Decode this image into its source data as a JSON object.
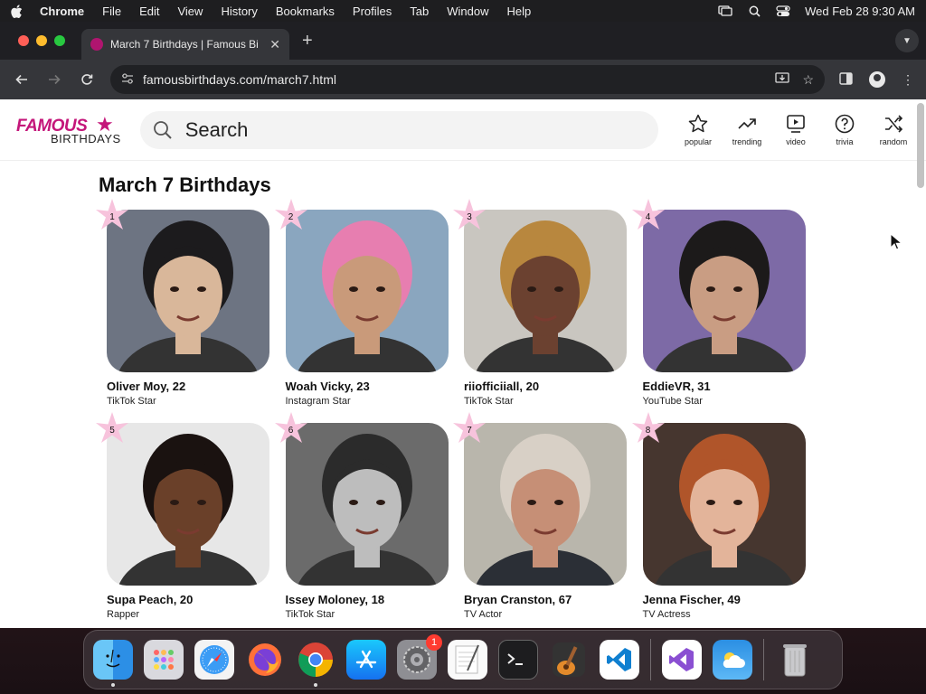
{
  "menubar": {
    "app_name": "Chrome",
    "items": [
      "File",
      "Edit",
      "View",
      "History",
      "Bookmarks",
      "Profiles",
      "Tab",
      "Window",
      "Help"
    ],
    "clock": "Wed Feb 28  9:30 AM"
  },
  "browser": {
    "tab_title": "March 7 Birthdays | Famous Bi",
    "url": "famousbirthdays.com/march7.html"
  },
  "site": {
    "logo_top": "FAMOUS",
    "logo_bottom": "BIRTHDAYS",
    "search_placeholder": "Search",
    "nav": [
      {
        "label": "popular",
        "icon": "star-icon"
      },
      {
        "label": "trending",
        "icon": "trending-icon"
      },
      {
        "label": "video",
        "icon": "video-icon"
      },
      {
        "label": "trivia",
        "icon": "question-icon"
      },
      {
        "label": "random",
        "icon": "shuffle-icon"
      }
    ],
    "heading": "March 7 Birthdays"
  },
  "celebrities": [
    {
      "rank": "1",
      "name": "Oliver Moy, 22",
      "job": "TikTok Star",
      "bg": "#6d7482",
      "skin": "#d9b79a",
      "hair": "#1c1b1d"
    },
    {
      "rank": "2",
      "name": "Woah Vicky, 23",
      "job": "Instagram Star",
      "bg": "#8aa6bf",
      "skin": "#c99a7a",
      "hair": "#e77eb0"
    },
    {
      "rank": "3",
      "name": "riiofficiiall, 20",
      "job": "TikTok Star",
      "bg": "#c9c6c0",
      "skin": "#6b4130",
      "hair": "#b8873e"
    },
    {
      "rank": "4",
      "name": "EddieVR, 31",
      "job": "YouTube Star",
      "bg": "#7d6aa6",
      "skin": "#c99d83",
      "hair": "#1c1a1a"
    },
    {
      "rank": "5",
      "name": "Supa Peach, 20",
      "job": "Rapper",
      "bg": "#e7e7e7",
      "skin": "#6a4029",
      "hair": "#1a1210"
    },
    {
      "rank": "6",
      "name": "Issey Moloney, 18",
      "job": "TikTok Star",
      "bg": "#6b6b6b",
      "skin": "#bdbdbd",
      "hair": "#2b2b2b"
    },
    {
      "rank": "7",
      "name": "Bryan Cranston, 67",
      "job": "TV Actor",
      "bg": "#b9b6ac",
      "skin": "#c68f76",
      "hair": "#d8d0c6"
    },
    {
      "rank": "8",
      "name": "Jenna Fischer, 49",
      "job": "TV Actress",
      "bg": "#46362f",
      "skin": "#e3b49a",
      "hair": "#b0552a"
    }
  ],
  "dock": {
    "badge_count": "1",
    "apps": [
      "finder",
      "launchpad",
      "safari",
      "firefox",
      "chrome",
      "app-store",
      "system-settings",
      "textedit",
      "terminal",
      "garageband",
      "vscode",
      "visual-studio",
      "weather",
      "trash"
    ]
  },
  "colors": {
    "brand": "#c4167a",
    "star_pink": "#f7c3dc"
  }
}
